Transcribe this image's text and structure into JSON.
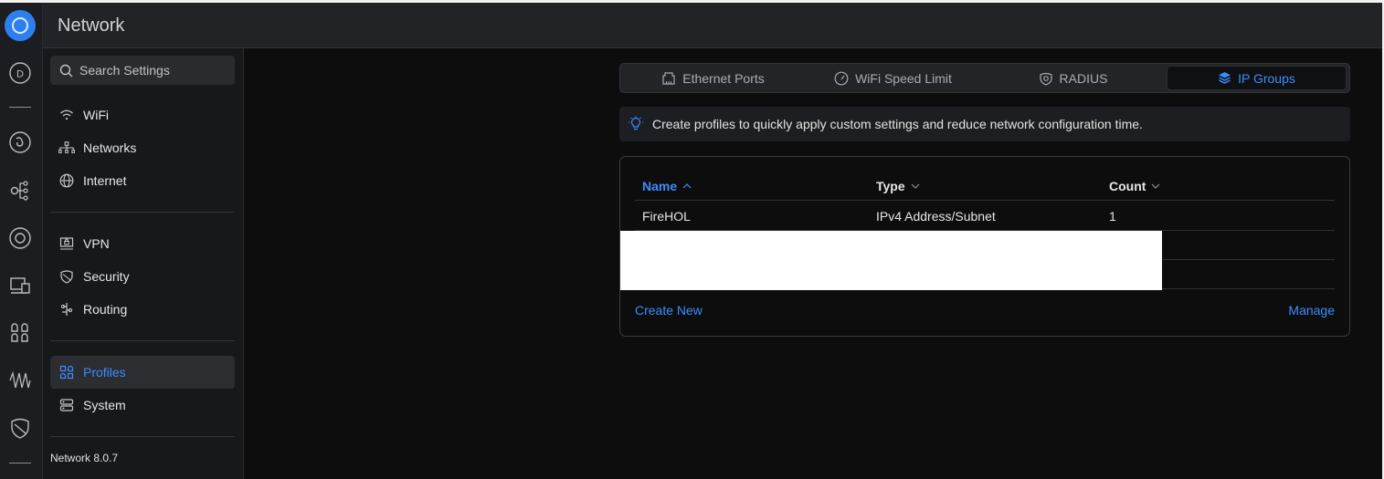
{
  "app": {
    "title": "Network",
    "version": "Network 8.0.7"
  },
  "search": {
    "placeholder": "Search Settings"
  },
  "rail": {
    "items": [
      {
        "icon": "dashboard-icon"
      },
      {
        "icon": "topology-icon"
      },
      {
        "icon": "devices-icon"
      },
      {
        "icon": "clients-icon"
      },
      {
        "icon": "monitor-icon"
      },
      {
        "icon": "apps-icon"
      },
      {
        "icon": "insights-icon"
      },
      {
        "icon": "shield-icon"
      }
    ]
  },
  "sidebar": {
    "items": [
      {
        "label": "WiFi",
        "icon": "wifi-icon"
      },
      {
        "label": "Networks",
        "icon": "networks-icon"
      },
      {
        "label": "Internet",
        "icon": "globe-icon"
      },
      {
        "label": "VPN",
        "icon": "vpn-icon"
      },
      {
        "label": "Security",
        "icon": "shield-icon"
      },
      {
        "label": "Routing",
        "icon": "routing-icon"
      },
      {
        "label": "Profiles",
        "icon": "profiles-icon",
        "active": true
      },
      {
        "label": "System",
        "icon": "system-icon"
      }
    ]
  },
  "tabs": [
    {
      "label": "Ethernet Ports",
      "icon": "ethernet-icon"
    },
    {
      "label": "WiFi Speed Limit",
      "icon": "speedometer-icon"
    },
    {
      "label": "RADIUS",
      "icon": "radius-icon"
    },
    {
      "label": "IP Groups",
      "icon": "layers-icon",
      "active": true
    }
  ],
  "banner": {
    "text": "Create profiles to quickly apply custom settings and reduce network configuration time.",
    "icon": "lightbulb-icon"
  },
  "table": {
    "columns": [
      {
        "label": "Name",
        "sort": "ascending"
      },
      {
        "label": "Type",
        "sort": "none"
      },
      {
        "label": "Count",
        "sort": "none"
      }
    ],
    "rows": [
      {
        "name": "FireHOL",
        "type": "IPv4 Address/Subnet",
        "count": "1"
      }
    ]
  },
  "actions": {
    "create": "Create New",
    "manage": "Manage"
  },
  "colors": {
    "accent": "#3c8cff",
    "background": "#0d0d0e",
    "sidebar": "#17181a",
    "header": "#222326"
  }
}
